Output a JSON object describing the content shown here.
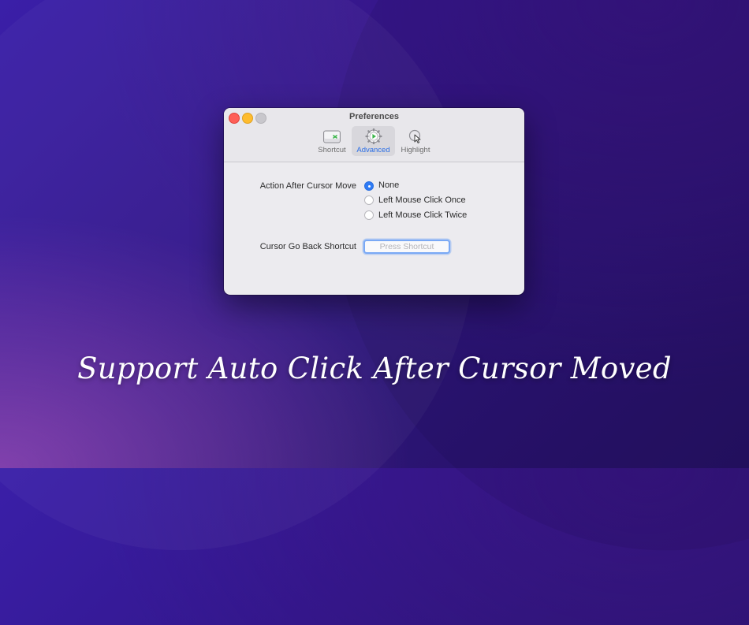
{
  "window": {
    "title": "Preferences",
    "tabs": [
      {
        "label": "Shortcut",
        "icon": "keyboard-icon"
      },
      {
        "label": "Advanced",
        "icon": "gear-play-icon",
        "selected": true
      },
      {
        "label": "Highlight",
        "icon": "cursor-click-icon"
      }
    ]
  },
  "advanced": {
    "action_label": "Action After Cursor Move",
    "options": [
      {
        "label": "None",
        "selected": true
      },
      {
        "label": "Left Mouse Click Once",
        "selected": false
      },
      {
        "label": "Left Mouse Click Twice",
        "selected": false
      }
    ],
    "shortcut_label": "Cursor Go Back Shortcut",
    "shortcut_placeholder": "Press Shortcut"
  },
  "caption": "Support Auto Click After Cursor Moved",
  "colors": {
    "accent": "#2f7bf5",
    "close": "#fe5f57",
    "minimize": "#febc2e",
    "background": "#33178d"
  }
}
